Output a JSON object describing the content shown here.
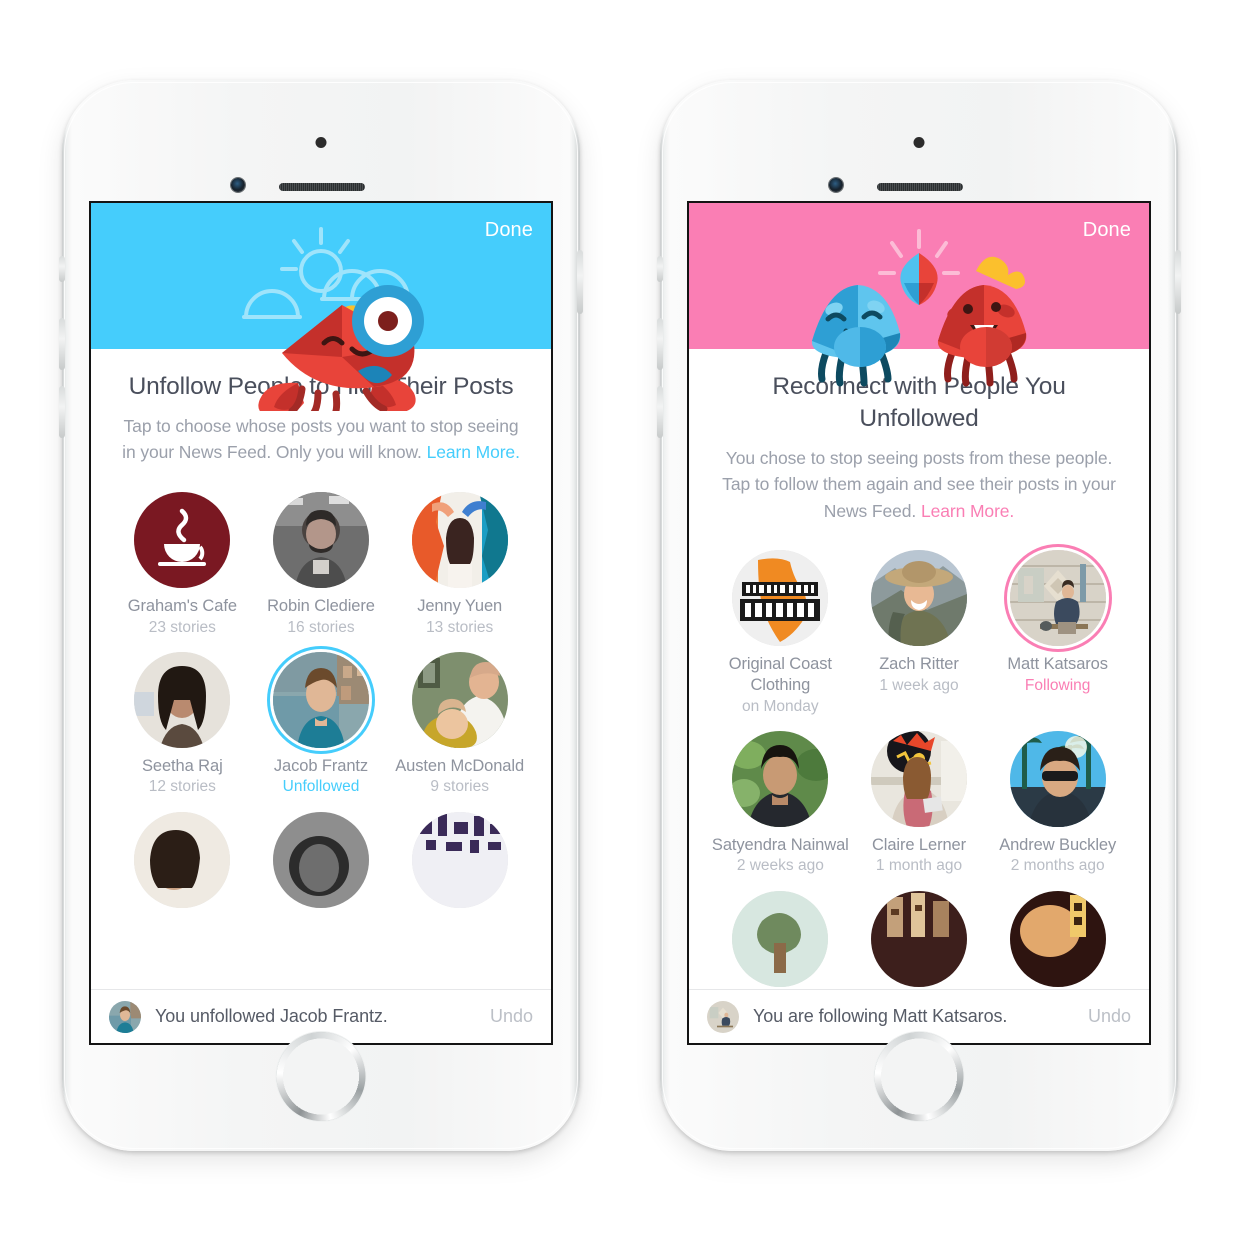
{
  "screens": [
    {
      "id": "unfollow",
      "accent": "#45cdfc",
      "header": {
        "done_label": "Done",
        "art": "crab-with-magnifier-sun-clouds-icon"
      },
      "headline": "Unfollow People to Hide Their Posts",
      "subtext": "Tap to choose whose posts you want to stop seeing in your News Feed. Only you will know. ",
      "learn_more": "Learn More.",
      "people": [
        {
          "name": "Graham's Cafe",
          "meta": "23 stories",
          "meta_state": "normal",
          "selected": false,
          "avatar": "coffee-cup-logo"
        },
        {
          "name": "Robin Clediere",
          "meta": "16 stories",
          "meta_state": "normal",
          "selected": false,
          "avatar": "man-bw-portrait"
        },
        {
          "name": "Jenny Yuen",
          "meta": "13 stories",
          "meta_state": "normal",
          "selected": false,
          "avatar": "woman-painted-mural"
        },
        {
          "name": "Seetha Raj",
          "meta": "12 stories",
          "meta_state": "normal",
          "selected": false,
          "avatar": "woman-dark-hair"
        },
        {
          "name": "Jacob Frantz",
          "meta": "Unfollowed",
          "meta_state": "accent",
          "selected": true,
          "avatar": "man-blue-shirt-coast"
        },
        {
          "name": "Austen McDonald",
          "meta": "9 stories",
          "meta_state": "normal",
          "selected": false,
          "avatar": "man-holding-baby"
        }
      ],
      "toast": {
        "text": "You unfollowed Jacob Frantz.",
        "undo_label": "Undo",
        "avatar": "man-blue-shirt-coast"
      }
    },
    {
      "id": "reconnect",
      "accent": "#fa7eb4",
      "header": {
        "done_label": "Done",
        "art": "two-crabs-high-five-icon"
      },
      "headline": "Reconnect with People You Unfollowed",
      "subtext": "You chose to stop seeing posts from these people. Tap to follow them again and see their posts in your News Feed. ",
      "learn_more": "Learn More.",
      "people": [
        {
          "name": "Original Coast Clothing",
          "meta": "on Monday",
          "meta_state": "normal",
          "selected": false,
          "avatar": "original-coast-clothing-logo"
        },
        {
          "name": "Zach Ritter",
          "meta": "1 week ago",
          "meta_state": "normal",
          "selected": false,
          "avatar": "man-hat-mountains"
        },
        {
          "name": "Matt Katsaros",
          "meta": "Following",
          "meta_state": "accent",
          "selected": true,
          "avatar": "man-sitting-cabin"
        },
        {
          "name": "Satyendra Nainwal",
          "meta": "2 weeks ago",
          "meta_state": "normal",
          "selected": false,
          "avatar": "man-green-foliage"
        },
        {
          "name": "Claire Lerner",
          "meta": "1 month ago",
          "meta_state": "normal",
          "selected": false,
          "avatar": "woman-balloon-office"
        },
        {
          "name": "Andrew Buckley",
          "meta": "2 months ago",
          "meta_state": "normal",
          "selected": false,
          "avatar": "man-sunglasses-palms"
        }
      ],
      "toast": {
        "text": "You are following Matt Katsaros.",
        "undo_label": "Undo",
        "avatar": "man-sitting-cabin"
      }
    }
  ]
}
